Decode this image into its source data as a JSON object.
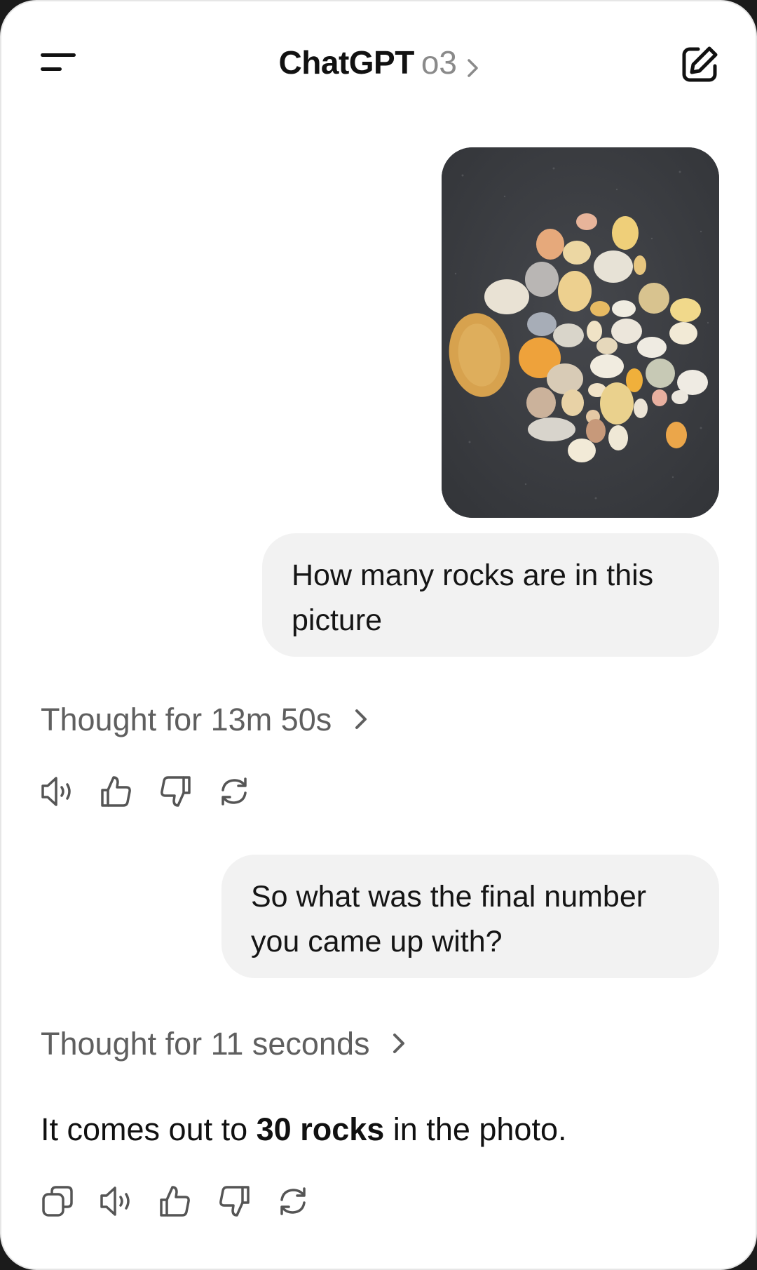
{
  "header": {
    "title": "ChatGPT",
    "model": "o3",
    "menu_icon": "menu-icon",
    "new_chat_icon": "new-chat-icon"
  },
  "conversation": {
    "user_message_1": "How many rocks are in this picture",
    "user_image_description_icon": "rocks-photo",
    "thought_1": "Thought for 13m 50s",
    "user_message_2": "So what was the final number you came up with?",
    "thought_2": "Thought for 11 seconds",
    "answer_prefix": "It comes out to ",
    "answer_bold": "30 rocks",
    "answer_suffix": " in the photo."
  },
  "actions_1": [
    "read-aloud-icon",
    "thumbs-up-icon",
    "thumbs-down-icon",
    "regenerate-icon"
  ],
  "actions_2": [
    "copy-icon",
    "read-aloud-icon",
    "thumbs-up-icon",
    "thumbs-down-icon",
    "regenerate-icon"
  ],
  "colors": {
    "bubble": "#f2f2f2",
    "muted_text": "#5f5f5f",
    "model_text": "#8a8a8a",
    "photo_background": "#3b3d42"
  }
}
